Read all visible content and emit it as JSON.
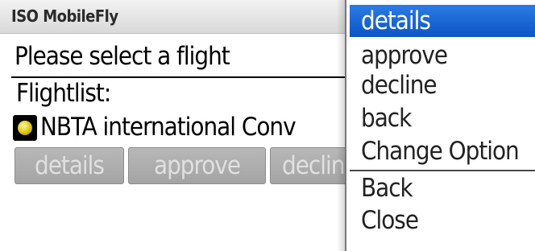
{
  "app": {
    "title": "ISO MobileFly"
  },
  "main": {
    "prompt": "Please select a flight",
    "list_label": "Flightlist:",
    "flight": {
      "name": "NBTA international Conv"
    }
  },
  "buttons": {
    "details": "details",
    "approve": "approve",
    "decline": "decline"
  },
  "menu": {
    "items": [
      {
        "label": "details",
        "selected": true
      },
      {
        "label": "approve"
      },
      {
        "label": "decline"
      },
      {
        "label": "back"
      },
      {
        "label": "Change Option"
      },
      {
        "label": "Back"
      },
      {
        "label": "Close"
      }
    ]
  },
  "colors": {
    "selection": "#0b55c4",
    "button_bg": "#aaaaaa",
    "radio_fill": "#e2c400"
  }
}
